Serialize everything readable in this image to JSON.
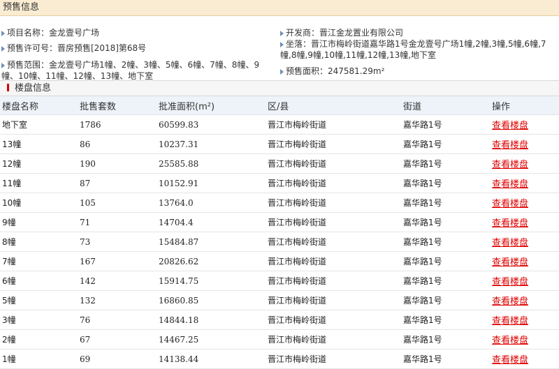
{
  "page_title": "预售信息",
  "info": {
    "project_name": "项目名称：金龙壹号广场",
    "developer": "开发商：晋江金龙置业有限公司",
    "presale_permit": "预售许可号：晋房预售[2018]第68号",
    "location": "坐落：晋江市梅岭街道嘉华路1号金龙壹号广场1幢,2幢,3幢,5幢,6幢,7幢,8幢,9幢,10幢,11幢,12幢,13幢,地下室",
    "presale_scope": "预售范围：金龙壹号广场1幢、2幢、3幢、5幢、6幢、7幢、8幢、9幢、10幢、11幢、12幢、13幢、地下室",
    "presale_area": "预售面积：247581.29m²"
  },
  "section_title": "楼盘信息",
  "table": {
    "headers": [
      "楼盘名称",
      "批售套数",
      "批准面积(m²)",
      "区/县",
      "街道",
      "操作"
    ],
    "rows": [
      {
        "name": "地下室",
        "units": "1786",
        "area": "60599.83",
        "district": "晋江市梅岭街道",
        "street": "嘉华路1号",
        "action": "查看楼盘"
      },
      {
        "name": "13幢",
        "units": "86",
        "area": "10237.31",
        "district": "晋江市梅岭街道",
        "street": "嘉华路1号",
        "action": "查看楼盘"
      },
      {
        "name": "12幢",
        "units": "190",
        "area": "25585.88",
        "district": "晋江市梅岭街道",
        "street": "嘉华路1号",
        "action": "查看楼盘"
      },
      {
        "name": "11幢",
        "units": "87",
        "area": "10152.91",
        "district": "晋江市梅岭街道",
        "street": "嘉华路1号",
        "action": "查看楼盘"
      },
      {
        "name": "10幢",
        "units": "105",
        "area": "13764.0",
        "district": "晋江市梅岭街道",
        "street": "嘉华路1号",
        "action": "查看楼盘"
      },
      {
        "name": "9幢",
        "units": "71",
        "area": "14704.4",
        "district": "晋江市梅岭街道",
        "street": "嘉华路1号",
        "action": "查看楼盘"
      },
      {
        "name": "8幢",
        "units": "73",
        "area": "15484.87",
        "district": "晋江市梅岭街道",
        "street": "嘉华路1号",
        "action": "查看楼盘"
      },
      {
        "name": "7幢",
        "units": "167",
        "area": "20826.62",
        "district": "晋江市梅岭街道",
        "street": "嘉华路1号",
        "action": "查看楼盘"
      },
      {
        "name": "6幢",
        "units": "142",
        "area": "15914.75",
        "district": "晋江市梅岭街道",
        "street": "嘉华路1号",
        "action": "查看楼盘"
      },
      {
        "name": "5幢",
        "units": "132",
        "area": "16860.85",
        "district": "晋江市梅岭街道",
        "street": "嘉华路1号",
        "action": "查看楼盘"
      },
      {
        "name": "3幢",
        "units": "76",
        "area": "14844.18",
        "district": "晋江市梅岭街道",
        "street": "嘉华路1号",
        "action": "查看楼盘"
      },
      {
        "name": "2幢",
        "units": "67",
        "area": "14467.25",
        "district": "晋江市梅岭街道",
        "street": "嘉华路1号",
        "action": "查看楼盘"
      },
      {
        "name": "1幢",
        "units": "69",
        "area": "14138.44",
        "district": "晋江市梅岭街道",
        "street": "嘉华路1号",
        "action": "查看楼盘"
      }
    ]
  },
  "colors": {
    "title_bg": "#f9ecd2",
    "link": "#e00000",
    "header_bg": "#eef3f9",
    "bullet": "#6e8fb5"
  }
}
